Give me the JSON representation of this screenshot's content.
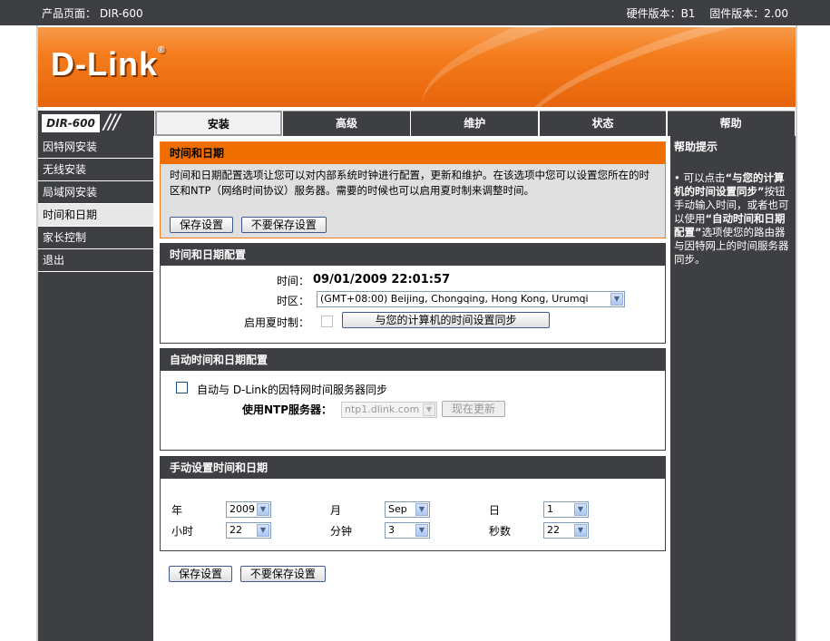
{
  "topbar": {
    "product_page": "产品页面： DIR-600",
    "hardware_version": "硬件版本：B1",
    "firmware_version": "固件版本：2.00"
  },
  "banner": {
    "logo_text": "D-Link",
    "logo_reg": "®"
  },
  "model": {
    "label": "DIR-600",
    "slashes": "///"
  },
  "tabs": [
    {
      "label": "安装",
      "active": true
    },
    {
      "label": "高级",
      "active": false
    },
    {
      "label": "维护",
      "active": false
    },
    {
      "label": "状态",
      "active": false
    },
    {
      "label": "帮助",
      "active": false
    }
  ],
  "sidebar": {
    "items": [
      {
        "label": "因特网安装"
      },
      {
        "label": "无线安装"
      },
      {
        "label": "局域网安装"
      },
      {
        "label": "时间和日期",
        "active": true
      },
      {
        "label": "家长控制"
      },
      {
        "label": "退出"
      }
    ]
  },
  "intro": {
    "title": "时间和日期",
    "text": "时间和日期配置选项让您可以对内部系统时钟进行配置，更新和维护。在该选项中您可以设置您所在的时区和NTP（网络时间协议）服务器。需要的时候也可以启用夏时制来调整时间。",
    "save_label": "保存设置",
    "dont_save_label": "不要保存设置"
  },
  "config": {
    "title": "时间和日期配置",
    "time_label": "时间：",
    "time_value": "09/01/2009 22:01:57",
    "zone_label": "时区：",
    "zone_value": "(GMT+08:00) Beijing, Chongqing, Hong Kong, Urumqi",
    "dst_label": "启用夏时制：",
    "sync_button": "与您的计算机的时间设置同步"
  },
  "auto": {
    "title": "自动时间和日期配置",
    "auto_sync_label": "自动与  D-Link的因特网时间服务器同步",
    "ntp_label": "使用NTP服务器：",
    "ntp_value": "ntp1.dlink.com",
    "update_now": "现在更新"
  },
  "manual": {
    "title": "手动设置时间和日期",
    "year_label": "年",
    "year_value": "2009",
    "month_label": "月",
    "month_value": "Sep",
    "day_label": "日",
    "day_value": "1",
    "hour_label": "小时",
    "hour_value": "22",
    "minute_label": "分钟",
    "minute_value": "3",
    "second_label": "秒数",
    "second_value": "22"
  },
  "bottom": {
    "save_label": "保存设置",
    "dont_save_label": "不要保存设置"
  },
  "help": {
    "title": "帮助提示",
    "bullet": "•",
    "p1": "可以点击",
    "b1": "“与您的计算机的时间设置同步”",
    "p2": "按钮手动输入时间，或者也可以使用",
    "b2": "“自动时间和日期配置”",
    "p3": "选项使您的路由器与因特网上的时间服务器同步。"
  },
  "icons": {
    "dropdown": "chevron-down-icon",
    "checkbox": "checkbox-icon"
  },
  "colors": {
    "accent": "#f06d00",
    "dark": "#3d3f42"
  }
}
